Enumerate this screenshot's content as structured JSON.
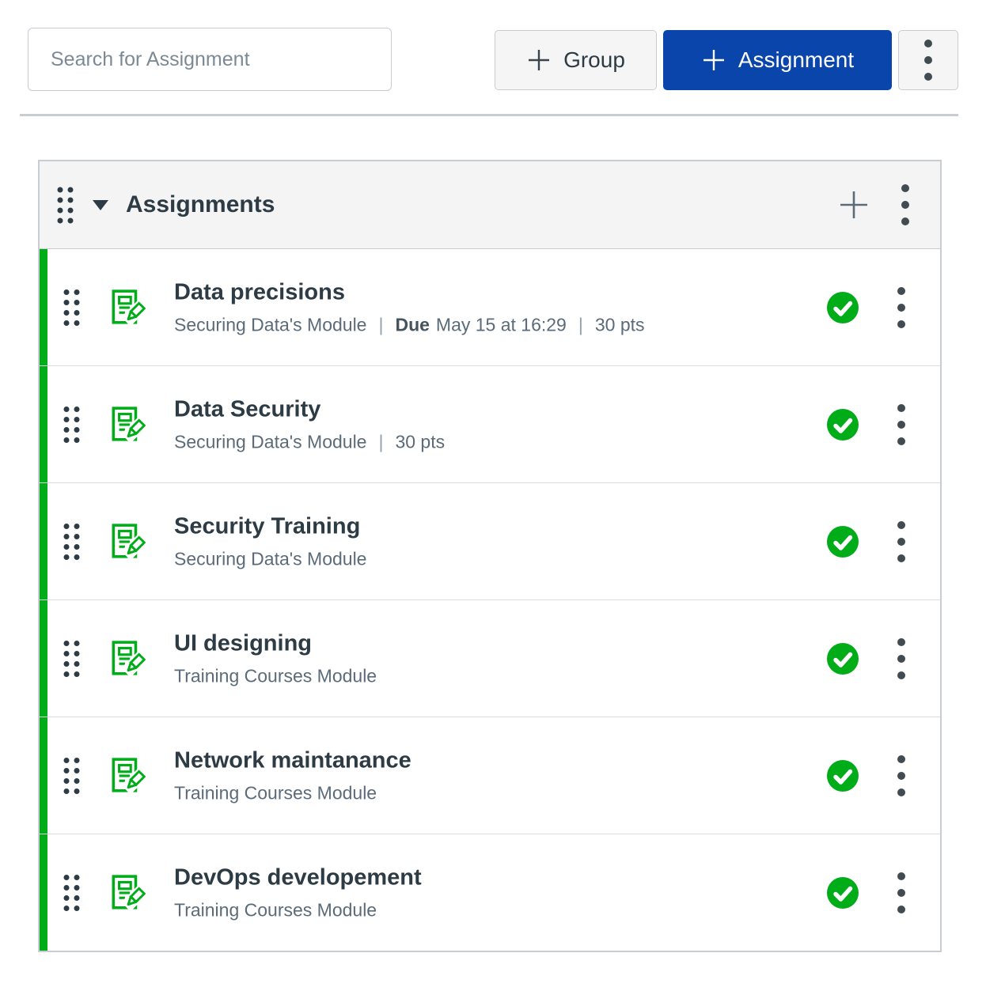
{
  "toolbar": {
    "search_placeholder": "Search for Assignment",
    "group_button_label": "Group",
    "assignment_button_label": "Assignment"
  },
  "group_header": {
    "title": "Assignments"
  },
  "rows": [
    {
      "title": "Data precisions",
      "module": "Securing Data's Module",
      "due_label": "Due",
      "due": "May 15 at 16:29",
      "points": "30 pts",
      "published": true
    },
    {
      "title": "Data Security",
      "module": "Securing Data's Module",
      "points": "30 pts",
      "published": true
    },
    {
      "title": "Security Training",
      "module": "Securing Data's Module",
      "published": true
    },
    {
      "title": "UI designing",
      "module": "Training Courses Module",
      "published": true
    },
    {
      "title": "Network maintanance",
      "module": "Training Courses Module",
      "published": true
    },
    {
      "title": "DevOps developement",
      "module": "Training Courses Module",
      "published": true
    }
  ],
  "ui": {
    "separator": "|"
  },
  "icons": {
    "plus": "plus-icon",
    "kebab": "kebab-menu-icon",
    "caret_down": "caret-down-icon",
    "drag_handle": "drag-handle-icon",
    "assignment": "assignment-document-pencil-icon",
    "published": "published-check-circle-icon"
  },
  "colors": {
    "primary_blue": "#0A45AC",
    "published_green": "#00AC18",
    "text_dark": "#2D3B45",
    "text_muted": "#5B6B79",
    "border": "#C7CDD1",
    "header_bg": "#F4F4F4",
    "button_bg": "#F5F5F5"
  }
}
